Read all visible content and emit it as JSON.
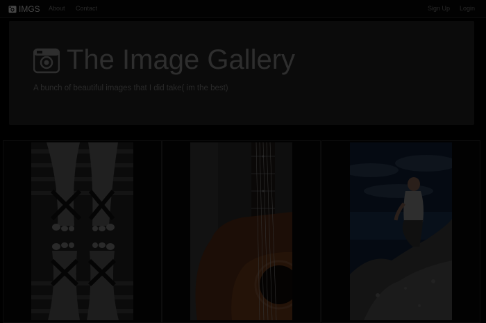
{
  "navbar": {
    "brand": "IMGS",
    "links": [
      "About",
      "Contact"
    ],
    "auth": [
      "Sign Up",
      "Login"
    ]
  },
  "jumbotron": {
    "title": "The Image Gallery",
    "subtitle": "A bunch of beautiful images that I did take( im the best)"
  },
  "gallery": {
    "images": [
      {
        "name": "feet-photo"
      },
      {
        "name": "guitar-photo"
      },
      {
        "name": "person-on-rock-photo"
      }
    ]
  },
  "colors": {
    "background": "#000000",
    "navbar": "#020202",
    "jumbotron": "#0b0b0b",
    "text_dim": "#2e2e2e"
  },
  "icons": {
    "brand": "camera-icon",
    "title": "camera-icon"
  }
}
